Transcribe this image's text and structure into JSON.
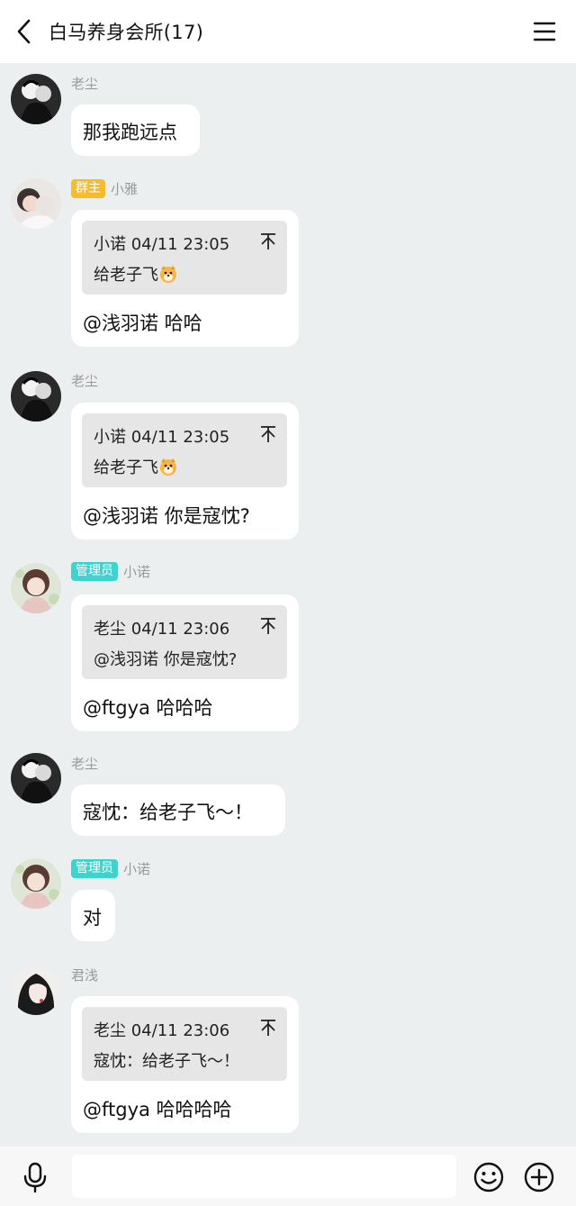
{
  "header": {
    "title": "白马养身会所(17)"
  },
  "messages": [
    {
      "name": "老尘",
      "badge": "",
      "text": "那我跑远点"
    },
    {
      "name": "小雅",
      "badge": "群主",
      "quote": {
        "head": "小诺 04/11 23:05",
        "body": "给老子飞"
      },
      "text": "@浅羽诺 哈哈"
    },
    {
      "name": "老尘",
      "badge": "",
      "quote": {
        "head": "小诺 04/11 23:05",
        "body": "给老子飞"
      },
      "text": "@浅羽诺 你是寇忱?"
    },
    {
      "name": "小诺",
      "badge": "管理员",
      "quote": {
        "head": "老尘 04/11 23:06",
        "body": "@浅羽诺 你是寇忱?"
      },
      "text": "@ftgya 哈哈哈"
    },
    {
      "name": "老尘",
      "badge": "",
      "text": "寇忱：给老子飞～！"
    },
    {
      "name": "小诺",
      "badge": "管理员",
      "text": "对"
    },
    {
      "name": "君浅",
      "badge": "",
      "quote": {
        "head": "老尘 04/11 23:06",
        "body": "寇忱：给老子飞～！"
      },
      "text": "@ftgya 哈哈哈哈"
    }
  ],
  "footer": {
    "input_placeholder": ""
  },
  "colors": {
    "owner_badge": "#f6bc2c",
    "admin_badge": "#3fd3cd",
    "background": "#eceff0"
  },
  "icons": [
    "back-arrow-icon",
    "menu-icon",
    "microphone-icon",
    "smile-icon",
    "plus-circle-icon",
    "jump-to-top-icon",
    "dog-emoji-icon"
  ]
}
